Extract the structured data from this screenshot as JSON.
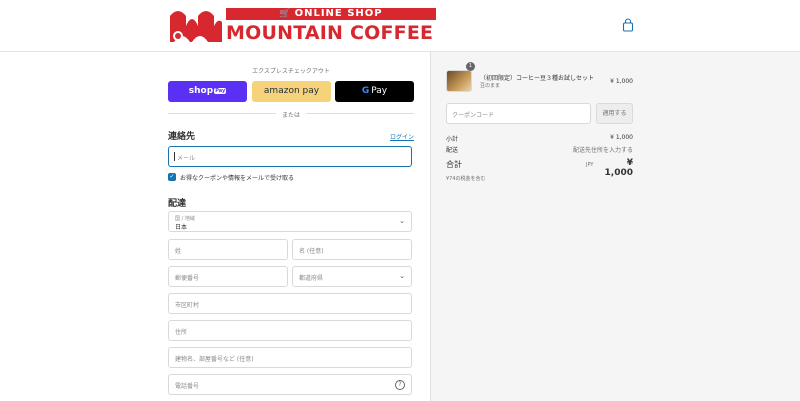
{
  "header": {
    "banner_text": "ONLINE SHOP",
    "brand_name": "MOUNTAIN COFFEE"
  },
  "express": {
    "label": "エクスプレスチェックアウト",
    "shop_pay": "shop",
    "shop_pay_tag": "Pay",
    "amazon_pay": "amazon pay",
    "google_pay_g": "G",
    "google_pay": "Pay",
    "or_text": "または"
  },
  "contact": {
    "title": "連絡先",
    "login_link": "ログイン",
    "email_placeholder": "メール",
    "newsletter_label": "お得なクーポンや情報をメールで受け取る",
    "newsletter_checked": true
  },
  "delivery": {
    "title": "配達",
    "country_label": "国 / 地域",
    "country_value": "日本",
    "last_name": "姓",
    "first_name": "名 (任意)",
    "postal_code": "郵便番号",
    "prefecture": "都道府県",
    "city": "市区町村",
    "address": "住所",
    "address2": "建物名、部屋番号など (任意)",
    "phone": "電話番号"
  },
  "summary": {
    "product_name": "（初回限定）コーヒー豆３種お試しセット",
    "product_variant": "豆のまま",
    "quantity": "1",
    "product_price": "¥ 1,000",
    "coupon_placeholder": "クーポンコード",
    "apply_button": "適用する",
    "subtotal_label": "小計",
    "subtotal_value": "¥ 1,000",
    "shipping_label": "配送",
    "shipping_value": "配送先住所を入力する",
    "total_label": "合計",
    "total_currency": "JPY",
    "total_value": "¥ 1,000",
    "tax_note": "¥74の税金を含む"
  },
  "colors": {
    "brand_red": "#d8282f",
    "link_blue": "#1773b0",
    "shop_pay_purple": "#5a31f4",
    "amazon_yellow": "#f6d37b",
    "sidebar_bg": "#f5f5f5"
  },
  "icons": {
    "bag": "shopping-bag-icon",
    "chevron": "chevron-down-icon",
    "help": "help-circle-icon",
    "check": "check-icon"
  }
}
